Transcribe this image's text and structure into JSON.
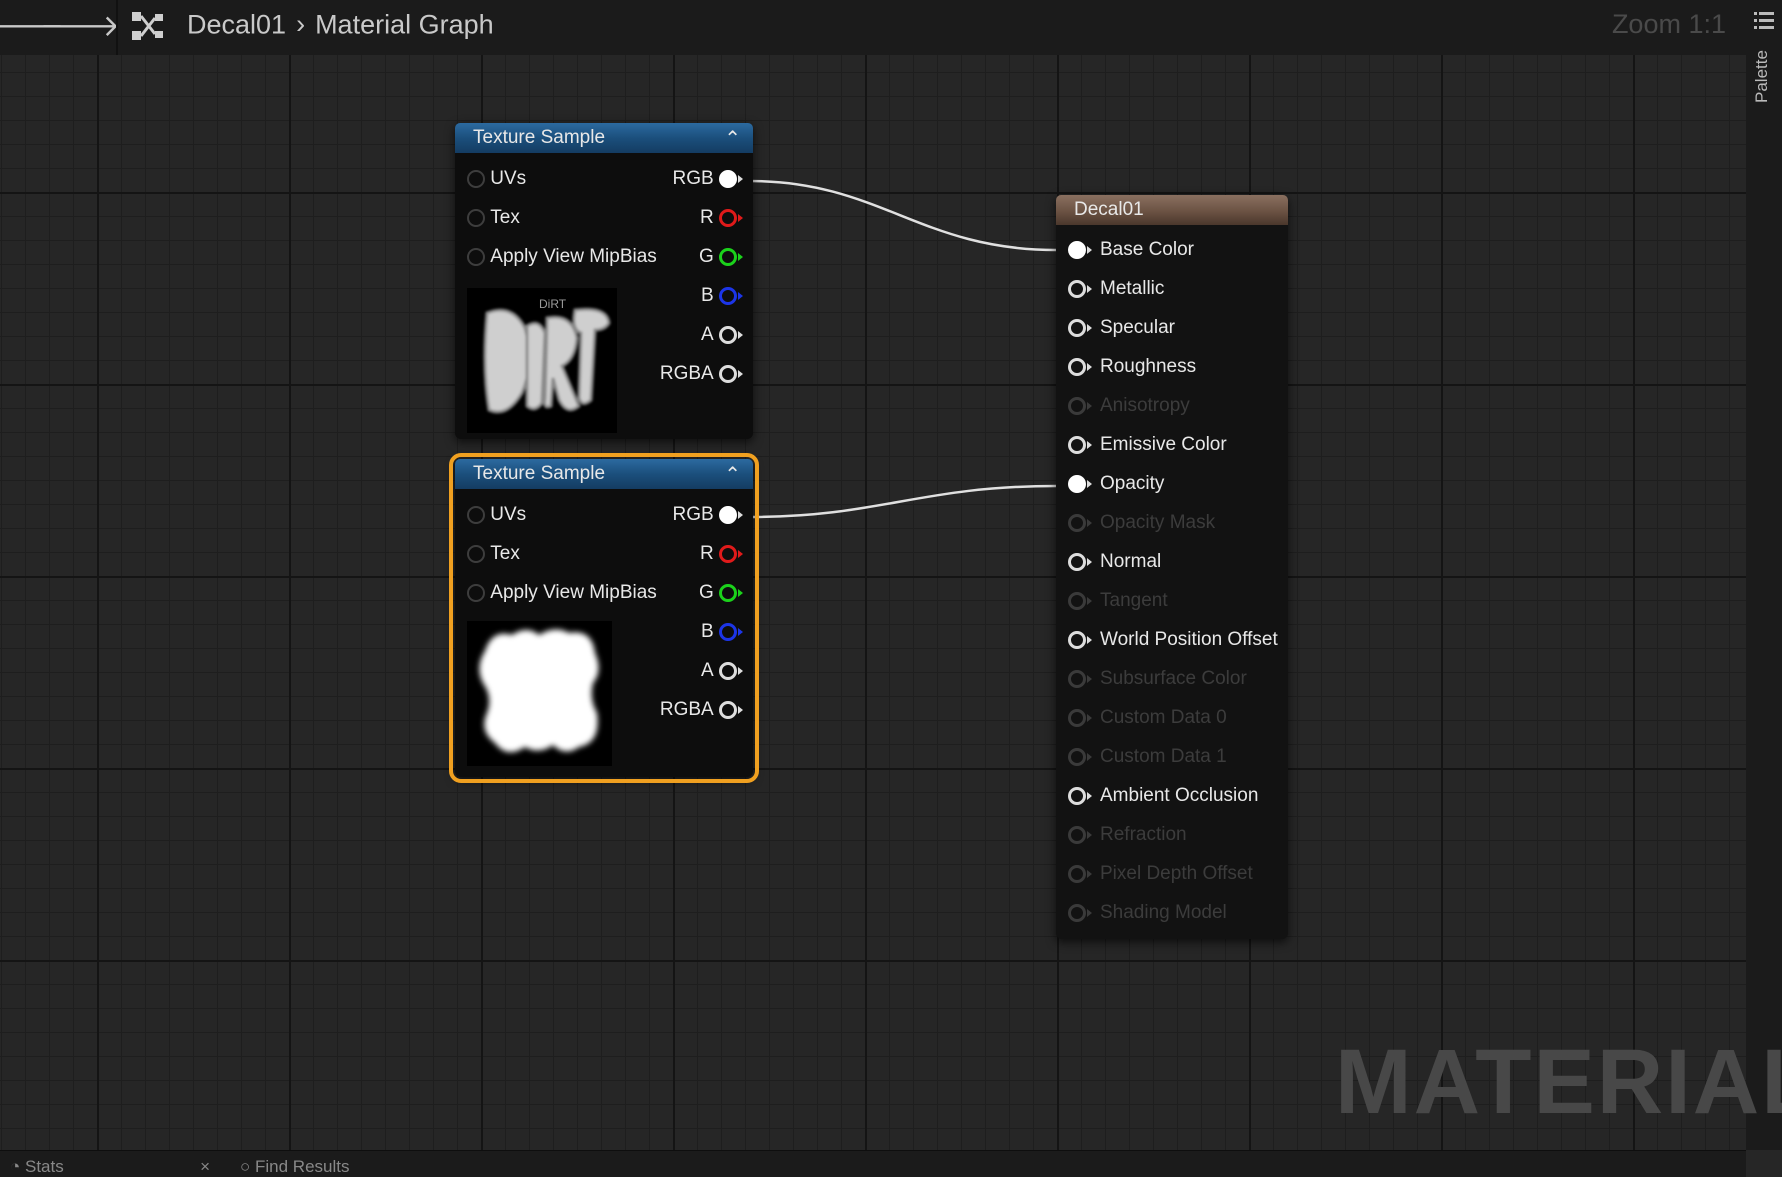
{
  "toolbar": {
    "back_icon": "back-arrow-icon",
    "forward_icon": "forward-arrow-icon",
    "breadcrumb": [
      "Decal01",
      "Material Graph"
    ],
    "zoom_label": "Zoom 1:1"
  },
  "right_panel": {
    "palette_label": "Palette"
  },
  "bottom_tabs": {
    "stats": "Stats",
    "find": "Find Results"
  },
  "watermark": "MATERIAL",
  "texture_nodes": [
    {
      "title": "Texture Sample",
      "selected": false,
      "preview": "DiRT",
      "inputs": [
        "UVs",
        "Tex",
        "Apply View MipBias"
      ],
      "outputs": [
        "RGB",
        "R",
        "G",
        "B",
        "A",
        "RGBA"
      ]
    },
    {
      "title": "Texture Sample",
      "selected": true,
      "preview": "",
      "inputs": [
        "UVs",
        "Tex",
        "Apply View MipBias"
      ],
      "outputs": [
        "RGB",
        "R",
        "G",
        "B",
        "A",
        "RGBA"
      ]
    }
  ],
  "material_node": {
    "title": "Decal01",
    "pins": [
      {
        "label": "Base Color",
        "enabled": true,
        "connected": true
      },
      {
        "label": "Metallic",
        "enabled": true,
        "connected": false
      },
      {
        "label": "Specular",
        "enabled": true,
        "connected": false
      },
      {
        "label": "Roughness",
        "enabled": true,
        "connected": false
      },
      {
        "label": "Anisotropy",
        "enabled": false,
        "connected": false
      },
      {
        "label": "Emissive Color",
        "enabled": true,
        "connected": false
      },
      {
        "label": "Opacity",
        "enabled": true,
        "connected": true
      },
      {
        "label": "Opacity Mask",
        "enabled": false,
        "connected": false
      },
      {
        "label": "Normal",
        "enabled": true,
        "connected": false
      },
      {
        "label": "Tangent",
        "enabled": false,
        "connected": false
      },
      {
        "label": "World Position Offset",
        "enabled": true,
        "connected": false
      },
      {
        "label": "Subsurface Color",
        "enabled": false,
        "connected": false
      },
      {
        "label": "Custom Data 0",
        "enabled": false,
        "connected": false
      },
      {
        "label": "Custom Data 1",
        "enabled": false,
        "connected": false
      },
      {
        "label": "Ambient Occlusion",
        "enabled": true,
        "connected": false
      },
      {
        "label": "Refraction",
        "enabled": false,
        "connected": false
      },
      {
        "label": "Pixel Depth Offset",
        "enabled": false,
        "connected": false
      },
      {
        "label": "Shading Model",
        "enabled": false,
        "connected": false
      }
    ]
  },
  "colors": {
    "pin_r": "#e01a1a",
    "pin_g": "#1bd21b",
    "pin_b": "#1c35e8",
    "selection": "#f0a020",
    "node_header_texture": "#1b4f7c",
    "node_header_material": "#6b5243"
  }
}
